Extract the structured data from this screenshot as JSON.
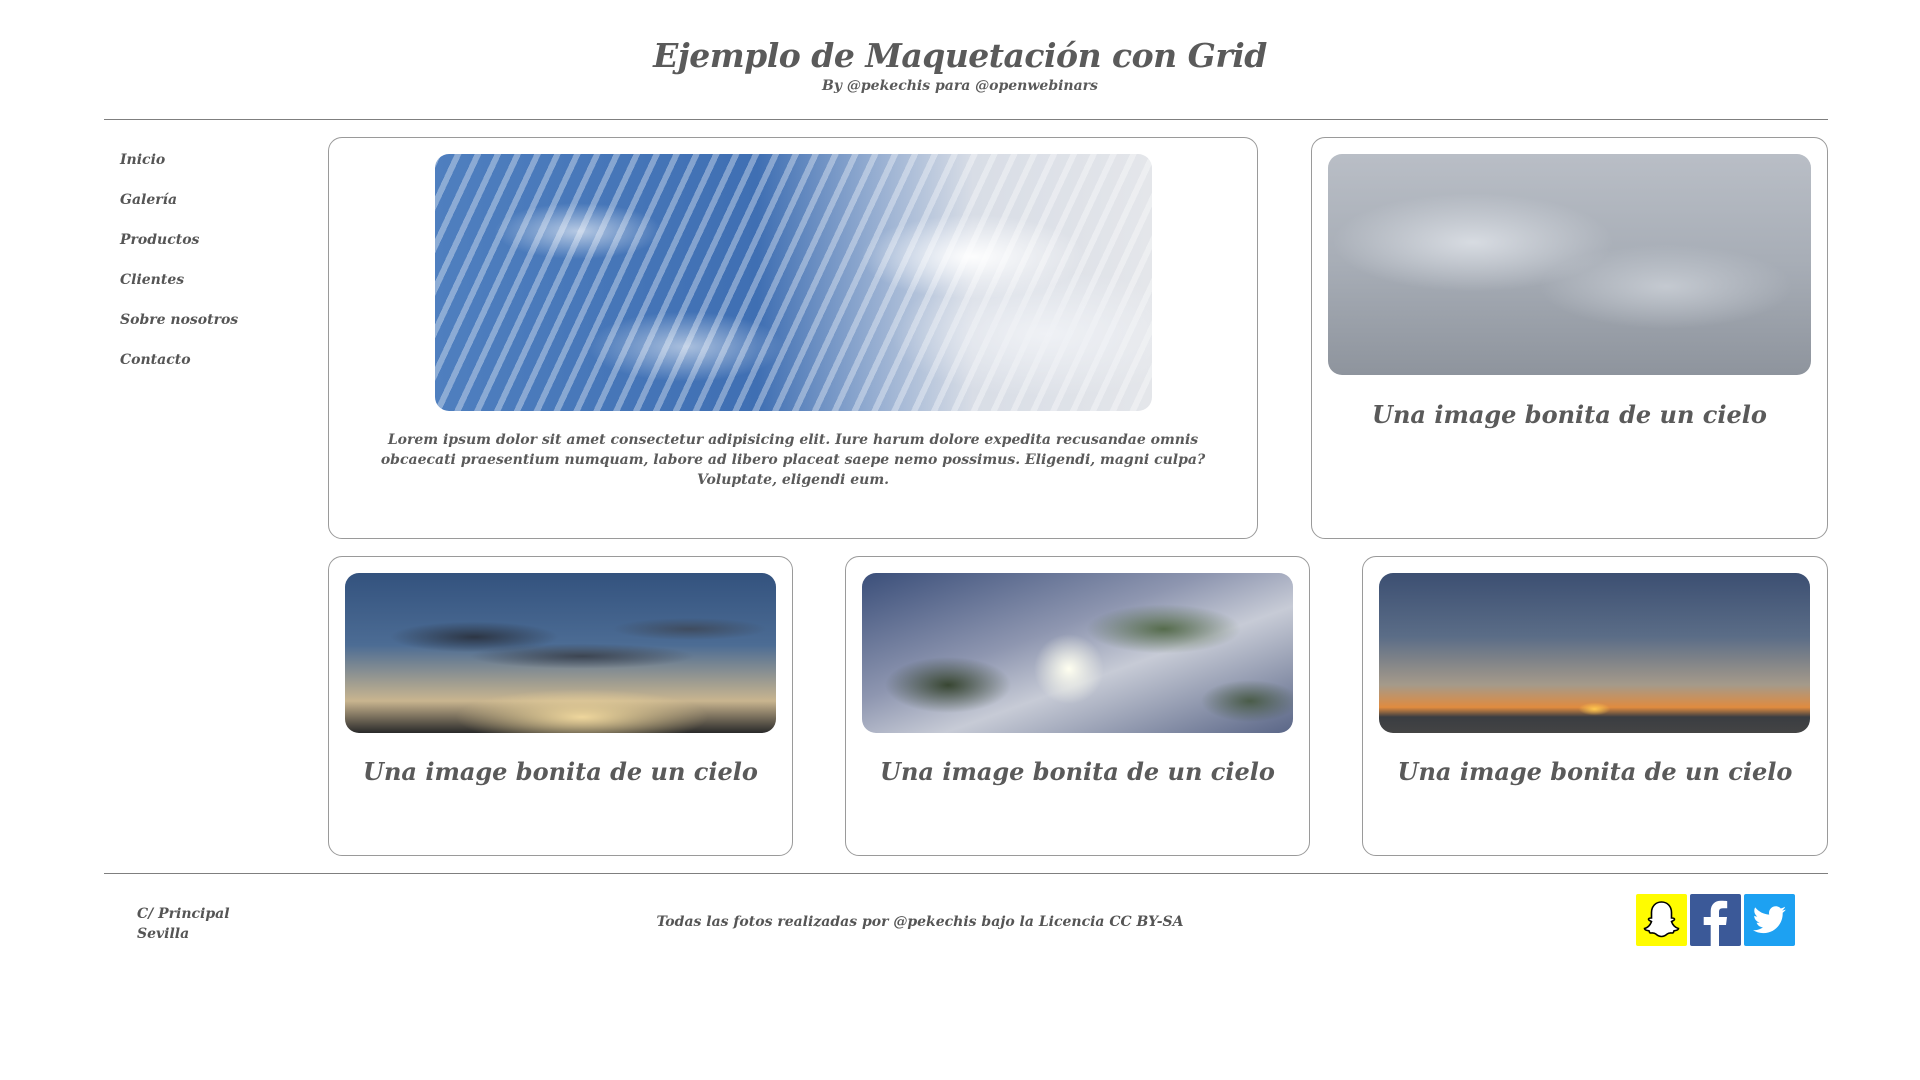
{
  "header": {
    "title": "Ejemplo de Maquetación con Grid",
    "subtitle": "By @pekechis para @openwebinars"
  },
  "sidebar": {
    "items": [
      {
        "label": "Inicio"
      },
      {
        "label": "Galería"
      },
      {
        "label": "Productos"
      },
      {
        "label": "Clientes"
      },
      {
        "label": "Sobre nosotros"
      },
      {
        "label": "Contacto"
      }
    ]
  },
  "main": {
    "featured": {
      "text": "Lorem ipsum dolor sit amet consectetur adipisicing elit. Iure harum dolore expedita recusandae omnis obcaecati praesentium numquam, labore ad libero placeat saepe nemo possimus. Eligendi, magni culpa? Voluptate, eligendi eum."
    },
    "cards": [
      {
        "caption": "Una image bonita de un cielo"
      },
      {
        "caption": "Una image bonita de un cielo"
      },
      {
        "caption": "Una image bonita de un cielo"
      },
      {
        "caption": "Una image bonita de un cielo"
      }
    ]
  },
  "footer": {
    "address_line1": "C/ Principal",
    "address_line2": "Sevilla",
    "credits": "Todas las fotos realizadas por @pekechis bajo la Licencia CC BY-SA",
    "social": [
      {
        "icon": "snapchat-icon",
        "color": "#fffc00"
      },
      {
        "icon": "facebook-icon",
        "color": "#3b5998"
      },
      {
        "icon": "twitter-icon",
        "color": "#1da1f2"
      }
    ]
  }
}
